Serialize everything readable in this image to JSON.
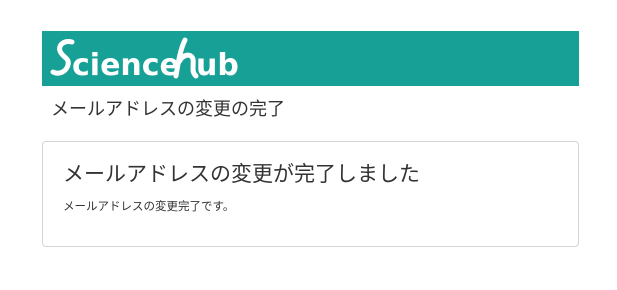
{
  "header": {
    "logo_text": "Sciencehub",
    "logo_visible_text": "Science hub",
    "background_color": "#17a096",
    "logo_color": "#ffffff"
  },
  "page": {
    "heading": "メールアドレスの変更の完了"
  },
  "panel": {
    "title": "メールアドレスの変更が完了しました",
    "message": "メールアドレスの変更完了です。"
  }
}
